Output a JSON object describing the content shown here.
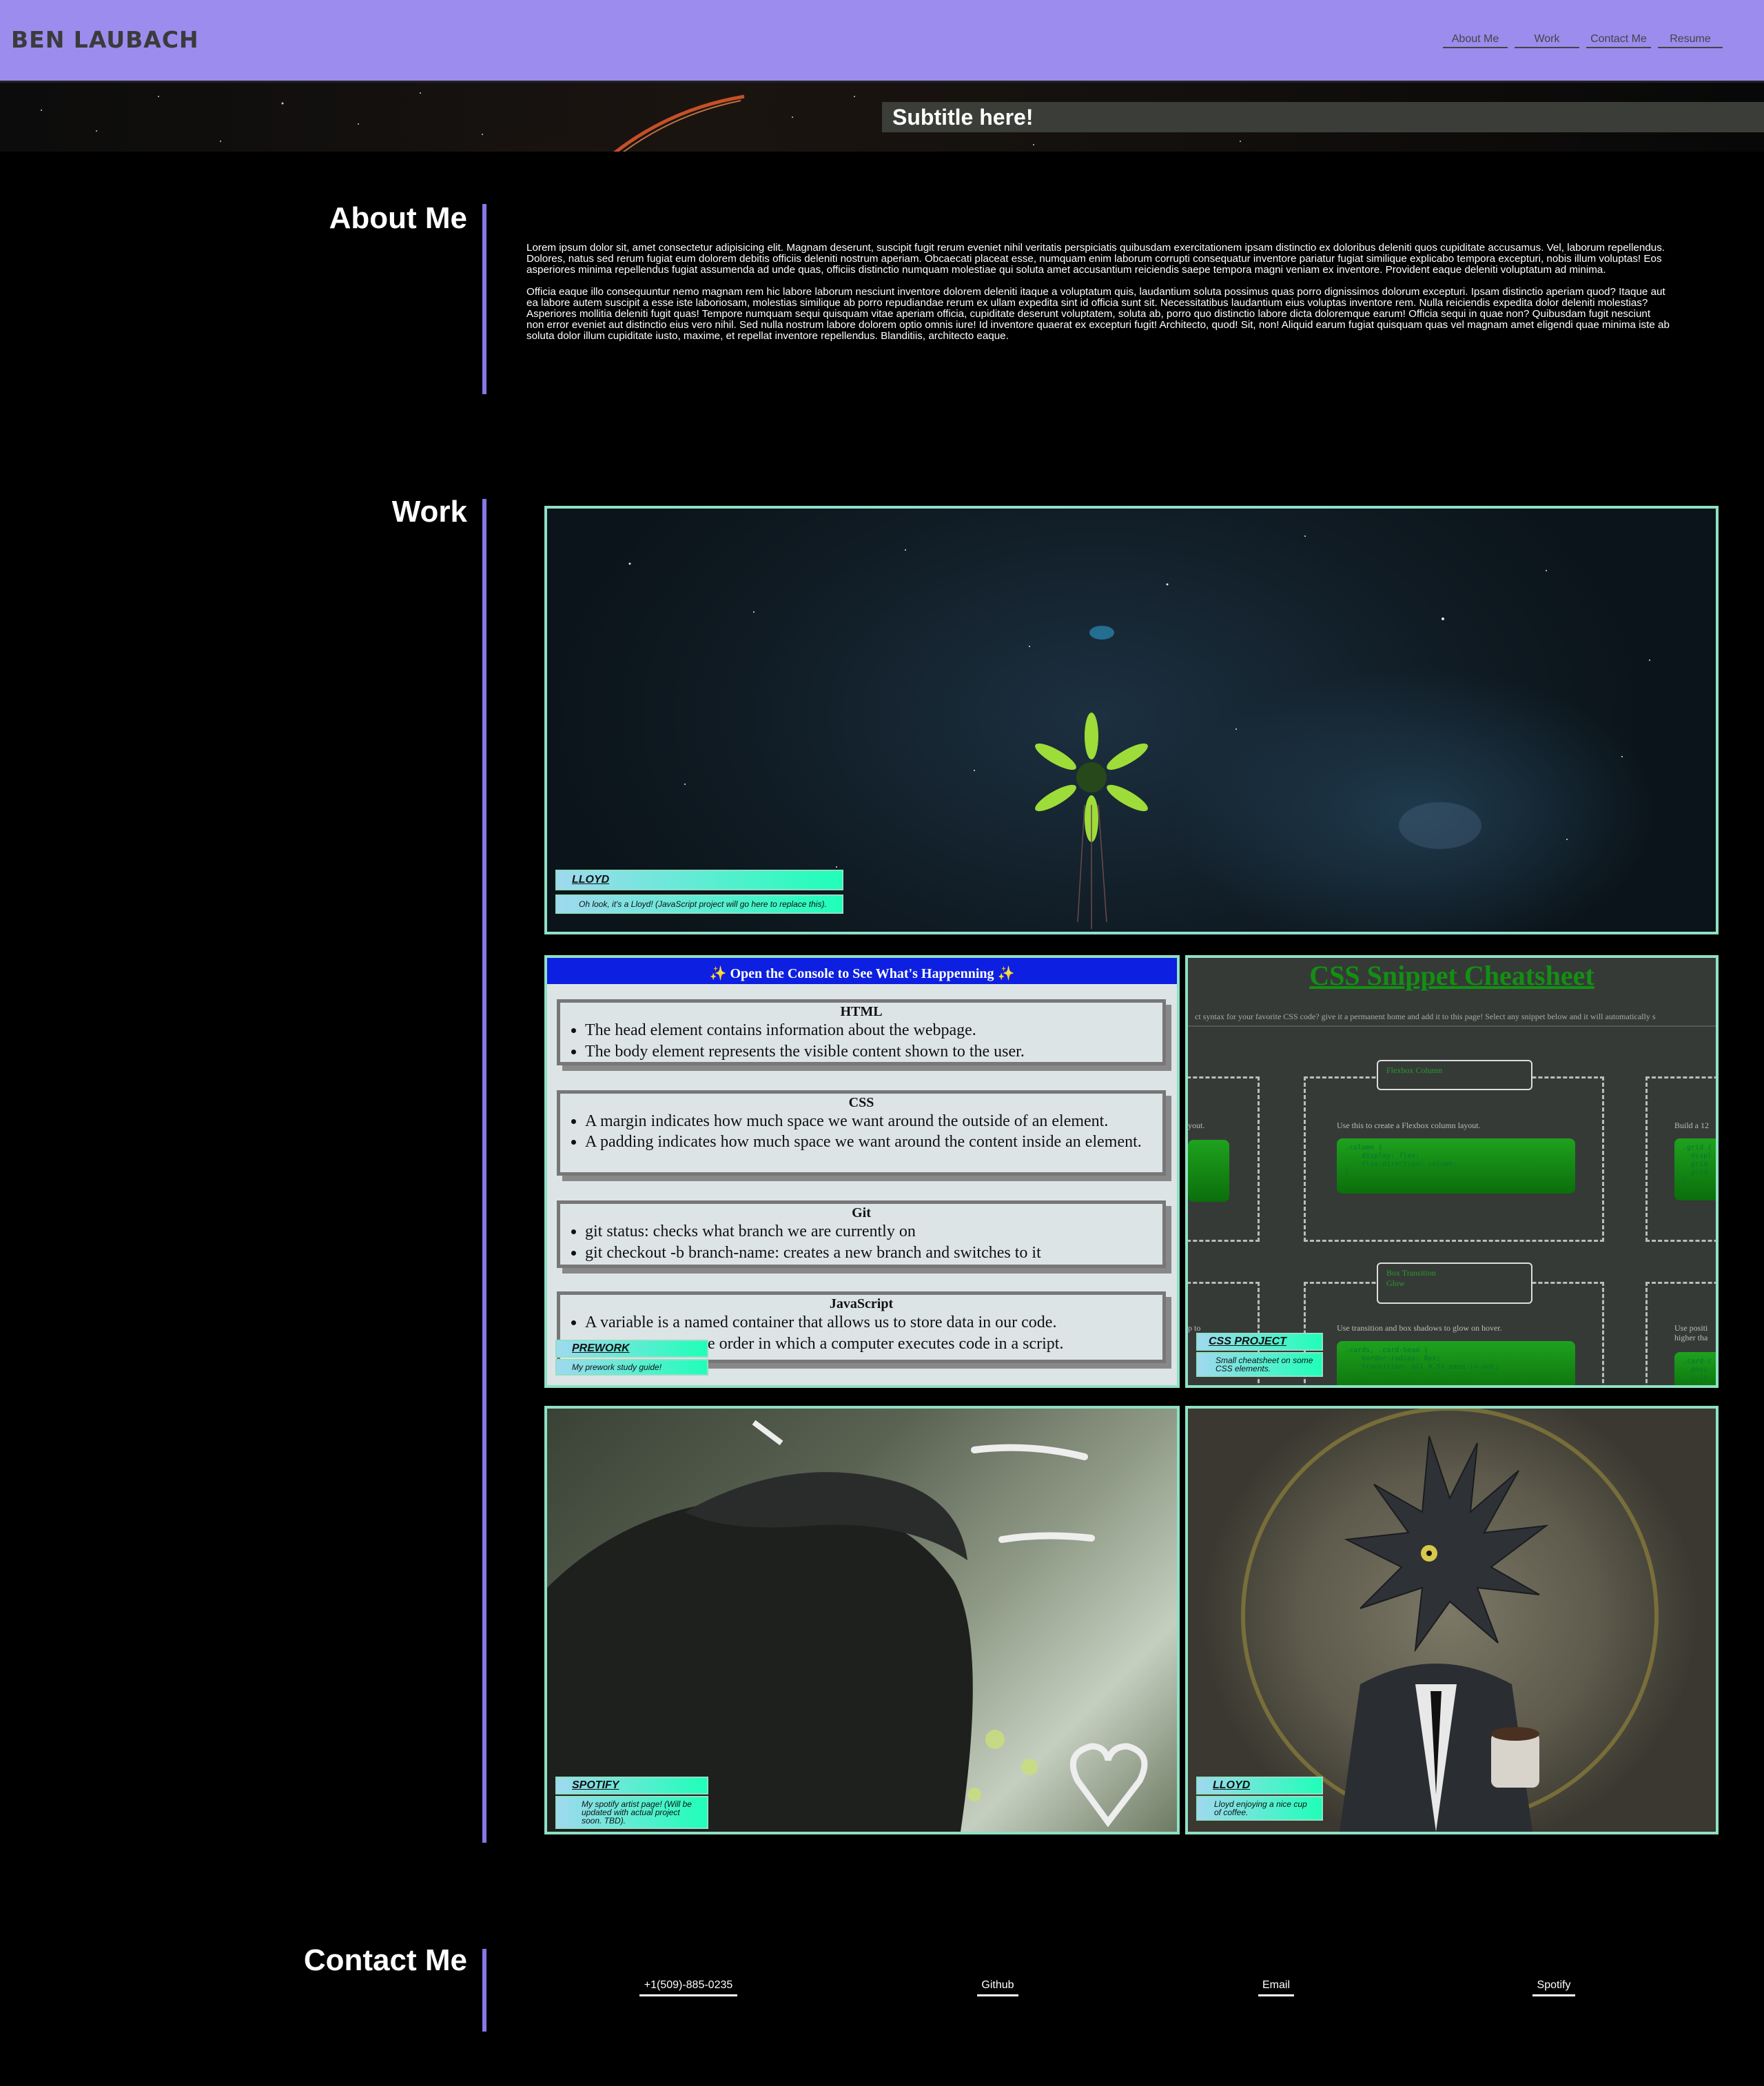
{
  "header": {
    "brand": "BEN LAUBACH",
    "nav": [
      "About Me",
      "Work",
      "Contact Me",
      "Resume"
    ]
  },
  "hero": {
    "subtitle": "Subtitle here!"
  },
  "about": {
    "title": "About Me",
    "paragraphs": [
      "Lorem ipsum dolor sit, amet consectetur adipisicing elit. Magnam deserunt, suscipit fugit rerum eveniet nihil veritatis perspiciatis quibusdam exercitationem ipsam distinctio ex doloribus deleniti quos cupiditate accusamus. Vel, laborum repellendus. Dolores, natus sed rerum fugiat eum dolorem debitis officiis deleniti nostrum aperiam. Obcaecati placeat esse, numquam enim laborum corrupti consequatur inventore pariatur fugiat similique explicabo tempora excepturi, nobis illum voluptas! Eos asperiores minima repellendus fugiat assumenda ad unde quas, officiis distinctio numquam molestiae qui soluta amet accusantium reiciendis saepe tempora magni veniam ex inventore. Provident eaque deleniti voluptatum ad minima.",
      "Officia eaque illo consequuntur nemo magnam rem hic labore laborum nesciunt inventore dolorem deleniti itaque a voluptatum quis, laudantium soluta possimus quas porro dignissimos dolorum excepturi. Ipsam distinctio aperiam quod? Itaque aut ea labore autem suscipit a esse iste laboriosam, molestias similique ab porro repudiandae rerum ex ullam expedita sint id officia sunt sit. Necessitatibus laudantium eius voluptas inventore rem. Nulla reiciendis expedita dolor deleniti molestias? Asperiores mollitia deleniti fugit quas! Tempore numquam sequi quisquam vitae aperiam officia, cupiditate deserunt voluptatem, soluta ab, porro quo distinctio labore dicta doloremque earum! Officia sequi in quae non? Quibusdam fugit nesciunt non error eveniet aut distinctio eius vero nihil. Sed nulla nostrum labore dolorem optio omnis iure! Id inventore quaerat ex excepturi fugit! Architecto, quod! Sit, non! Aliquid earum fugiat quisquam quas vel magnam amet eligendi quae minima iste ab soluta dolor illum cupiditate iusto, maxime, et repellat inventore repellendus. Blanditiis, architecto eaque."
    ]
  },
  "work": {
    "title": "Work",
    "projects": [
      {
        "title": "LLOYD",
        "desc": "Oh look, it's a Lloyd! (JavaScript project will go here to replace this)."
      },
      {
        "title": "PREWORK",
        "desc": "My prework study guide!"
      },
      {
        "title": "CSS PROJECT",
        "desc": "Small cheatsheet on some CSS elements."
      },
      {
        "title": "SPOTIFY",
        "desc": "My spotify artist page! (Will be updated with actual project soon. TBD)."
      },
      {
        "title": "LLOYD",
        "desc": "Lloyd enjoying a nice cup of coffee."
      }
    ],
    "prework": {
      "header": "✨ Open the Console to See What's Happenning ✨",
      "sections": [
        {
          "heading": "HTML",
          "items": [
            "The head element contains information about the webpage.",
            "The body element represents the visible content shown to the user."
          ]
        },
        {
          "heading": "CSS",
          "items": [
            "A margin indicates how much space we want around the outside of an element.",
            "A padding indicates how much space we want around the content inside an element."
          ]
        },
        {
          "heading": "Git",
          "items": [
            "git status: checks what branch we are currently on",
            "git checkout -b branch-name: creates a new branch and switches to it"
          ]
        },
        {
          "heading": "JavaScript",
          "items": [
            "A variable is a named container that allows us to store data in our code.",
            "e order in which a computer executes code in a script."
          ]
        }
      ]
    },
    "cheatsheet": {
      "title": "CSS Snippet Cheatsheet",
      "subtitle": "ct syntax for your favorite CSS code? give it a permanent home and add it to this page! Select any snippet below and it will automatically s",
      "tiles": [
        {
          "pill": "Flexbox Column",
          "text": "Use this to create a Flexbox column layout.",
          "code": ".column {\n    display: flex;\n    flex-direction: column;\n}"
        },
        {
          "pill": "Box Transition\nGlow",
          "text": "Use transition and box shadows to glow on hover.",
          "code": ".cards, .card-head {\n    border-radius: 8px;\n    transition: all 0.5s ease-in-out;"
        }
      ],
      "left_fragment_1": "yout.",
      "left_fragment_2": "p to",
      "right_fragment_1": "Build a 12",
      "right_fragment_2": "Use positi\nhigher tha",
      "right_code_1": ".grid {\n  displ\n  grid\n  grid\n}",
      "right_code_2": ".card-c\n  posi\n  z-in"
    }
  },
  "contact": {
    "title": "Contact Me",
    "links": [
      "+1(509)-885-0235",
      "Github",
      "Email",
      "Spotify"
    ]
  }
}
